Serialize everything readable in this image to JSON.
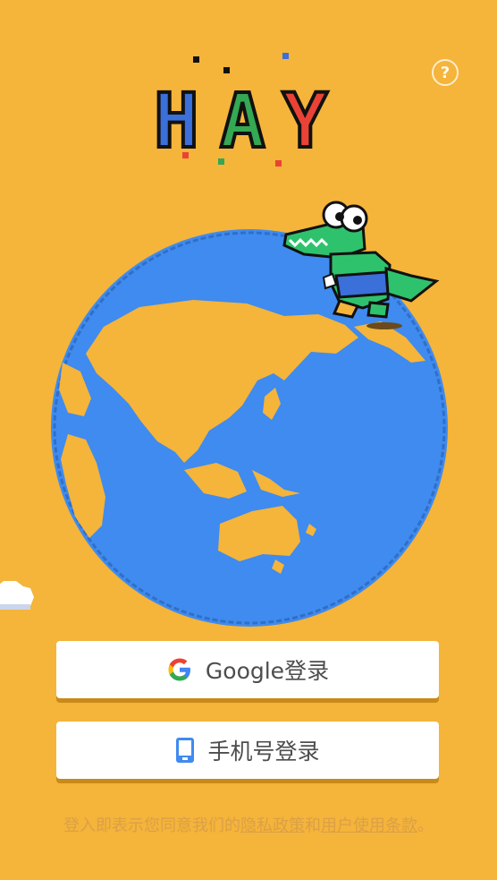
{
  "logo": {
    "letters": [
      "H",
      "A",
      "Y"
    ]
  },
  "help": {
    "label": "?"
  },
  "buttons": {
    "google_label": "Google登录",
    "phone_label": "手机号登录"
  },
  "legal": {
    "prefix": "登入即表示您同意我们的",
    "privacy": "隐私政策",
    "and": "和",
    "terms": "用户使用条款",
    "suffix": "。"
  },
  "colors": {
    "background": "#f5b43a",
    "ocean": "#3f8bef",
    "land": "#f5b43a",
    "croc": "#2fc26d"
  },
  "icons": {
    "help": "help-icon",
    "google": "google-g-icon",
    "phone": "phone-icon"
  }
}
